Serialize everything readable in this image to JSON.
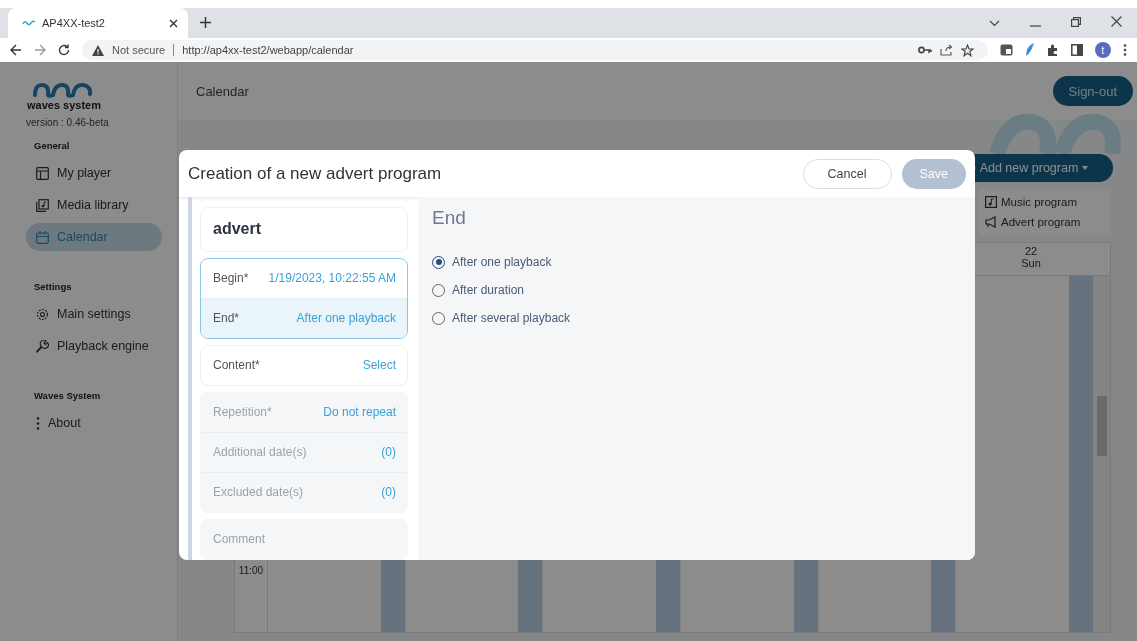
{
  "browser": {
    "tab_title": "AP4XX-test2",
    "security": "Not secure",
    "url": "http://ap4xx-test2/webapp/calendar",
    "avatar_letter": "t"
  },
  "sidebar": {
    "logo_text": "waves system",
    "version": "version : 0.46-beta",
    "sections": [
      {
        "title": "General",
        "items": [
          {
            "label": "My player",
            "selected": false
          },
          {
            "label": "Media library",
            "selected": false
          },
          {
            "label": "Calendar",
            "selected": true
          }
        ]
      },
      {
        "title": "Settings",
        "items": [
          {
            "label": "Main settings",
            "selected": false
          },
          {
            "label": "Playback engine",
            "selected": false
          }
        ]
      },
      {
        "title": "Waves System",
        "items": [
          {
            "label": "About",
            "selected": false
          }
        ]
      }
    ]
  },
  "header": {
    "title": "Calendar",
    "sign_out": "Sign-out"
  },
  "calendar": {
    "add_button": "Add new program",
    "menu": [
      {
        "label": "Music program"
      },
      {
        "label": "Advert program"
      }
    ],
    "day_number": "22",
    "day_name": "Sun",
    "time": "11:00"
  },
  "modal": {
    "title": "Creation of a new advert program",
    "cancel": "Cancel",
    "save": {
      "label": "Save",
      "disabled": true
    },
    "summary": [
      {
        "kind": "title",
        "text": "advert"
      },
      {
        "kind": "fields",
        "disabled": false,
        "fields": [
          {
            "label": "Begin*",
            "value": "1/19/2023, 10:22:55 AM",
            "selected": false
          },
          {
            "label": "End*",
            "value": "After one playback",
            "selected": true
          }
        ]
      },
      {
        "kind": "fields",
        "disabled": false,
        "fields": [
          {
            "label": "Content*",
            "value": "Select",
            "selected": false
          }
        ]
      },
      {
        "kind": "fields",
        "disabled": true,
        "fields": [
          {
            "label": "Repetition*",
            "value": "Do not repeat",
            "selected": false
          },
          {
            "label": "Additional date(s)",
            "value": "(0)",
            "selected": false
          },
          {
            "label": "Excluded date(s)",
            "value": "(0)",
            "selected": false
          }
        ]
      },
      {
        "kind": "fields",
        "disabled": true,
        "fields": [
          {
            "label": "Comment",
            "selected": false
          }
        ]
      }
    ],
    "panel": {
      "heading": "End",
      "options": [
        {
          "label": "After one playback",
          "selected": true
        },
        {
          "label": "After duration",
          "selected": false
        },
        {
          "label": "After several playback",
          "selected": false
        }
      ]
    }
  }
}
